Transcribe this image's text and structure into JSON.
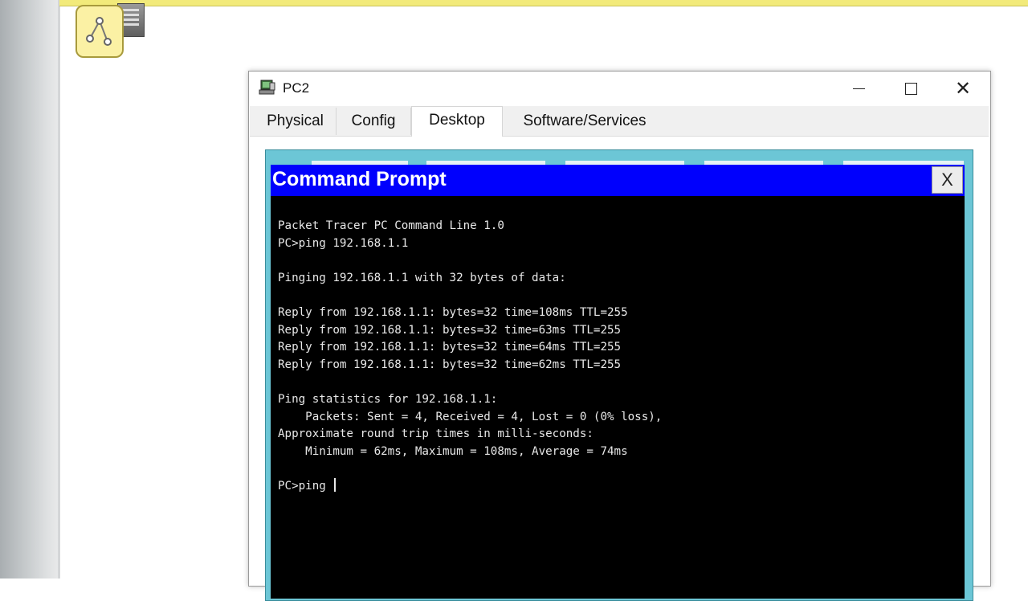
{
  "window": {
    "title": "PC2",
    "controls": {
      "minimize": "minimize",
      "maximize": "maximize",
      "close": "✕"
    }
  },
  "tabs": [
    {
      "label": "Physical",
      "active": false
    },
    {
      "label": "Config",
      "active": false
    },
    {
      "label": "Desktop",
      "active": true
    },
    {
      "label": "Software/Services",
      "active": false
    }
  ],
  "command_prompt": {
    "title": "Command Prompt",
    "close_label": "X",
    "lines": [
      "Packet Tracer PC Command Line 1.0",
      "PC>ping 192.168.1.1",
      "",
      "Pinging 192.168.1.1 with 32 bytes of data:",
      "",
      "Reply from 192.168.1.1: bytes=32 time=108ms TTL=255",
      "Reply from 192.168.1.1: bytes=32 time=63ms TTL=255",
      "Reply from 192.168.1.1: bytes=32 time=64ms TTL=255",
      "Reply from 192.168.1.1: bytes=32 time=62ms TTL=255",
      "",
      "Ping statistics for 192.168.1.1:",
      "    Packets: Sent = 4, Received = 4, Lost = 0 (0% loss),",
      "Approximate round trip times in milli-seconds:",
      "    Minimum = 62ms, Maximum = 108ms, Average = 74ms",
      ""
    ],
    "input_line": "PC>ping "
  },
  "colors": {
    "cmd_title_bg": "#0000fd",
    "desktop_bg": "#6cc6d6",
    "top_band": "#f2ea7a"
  }
}
